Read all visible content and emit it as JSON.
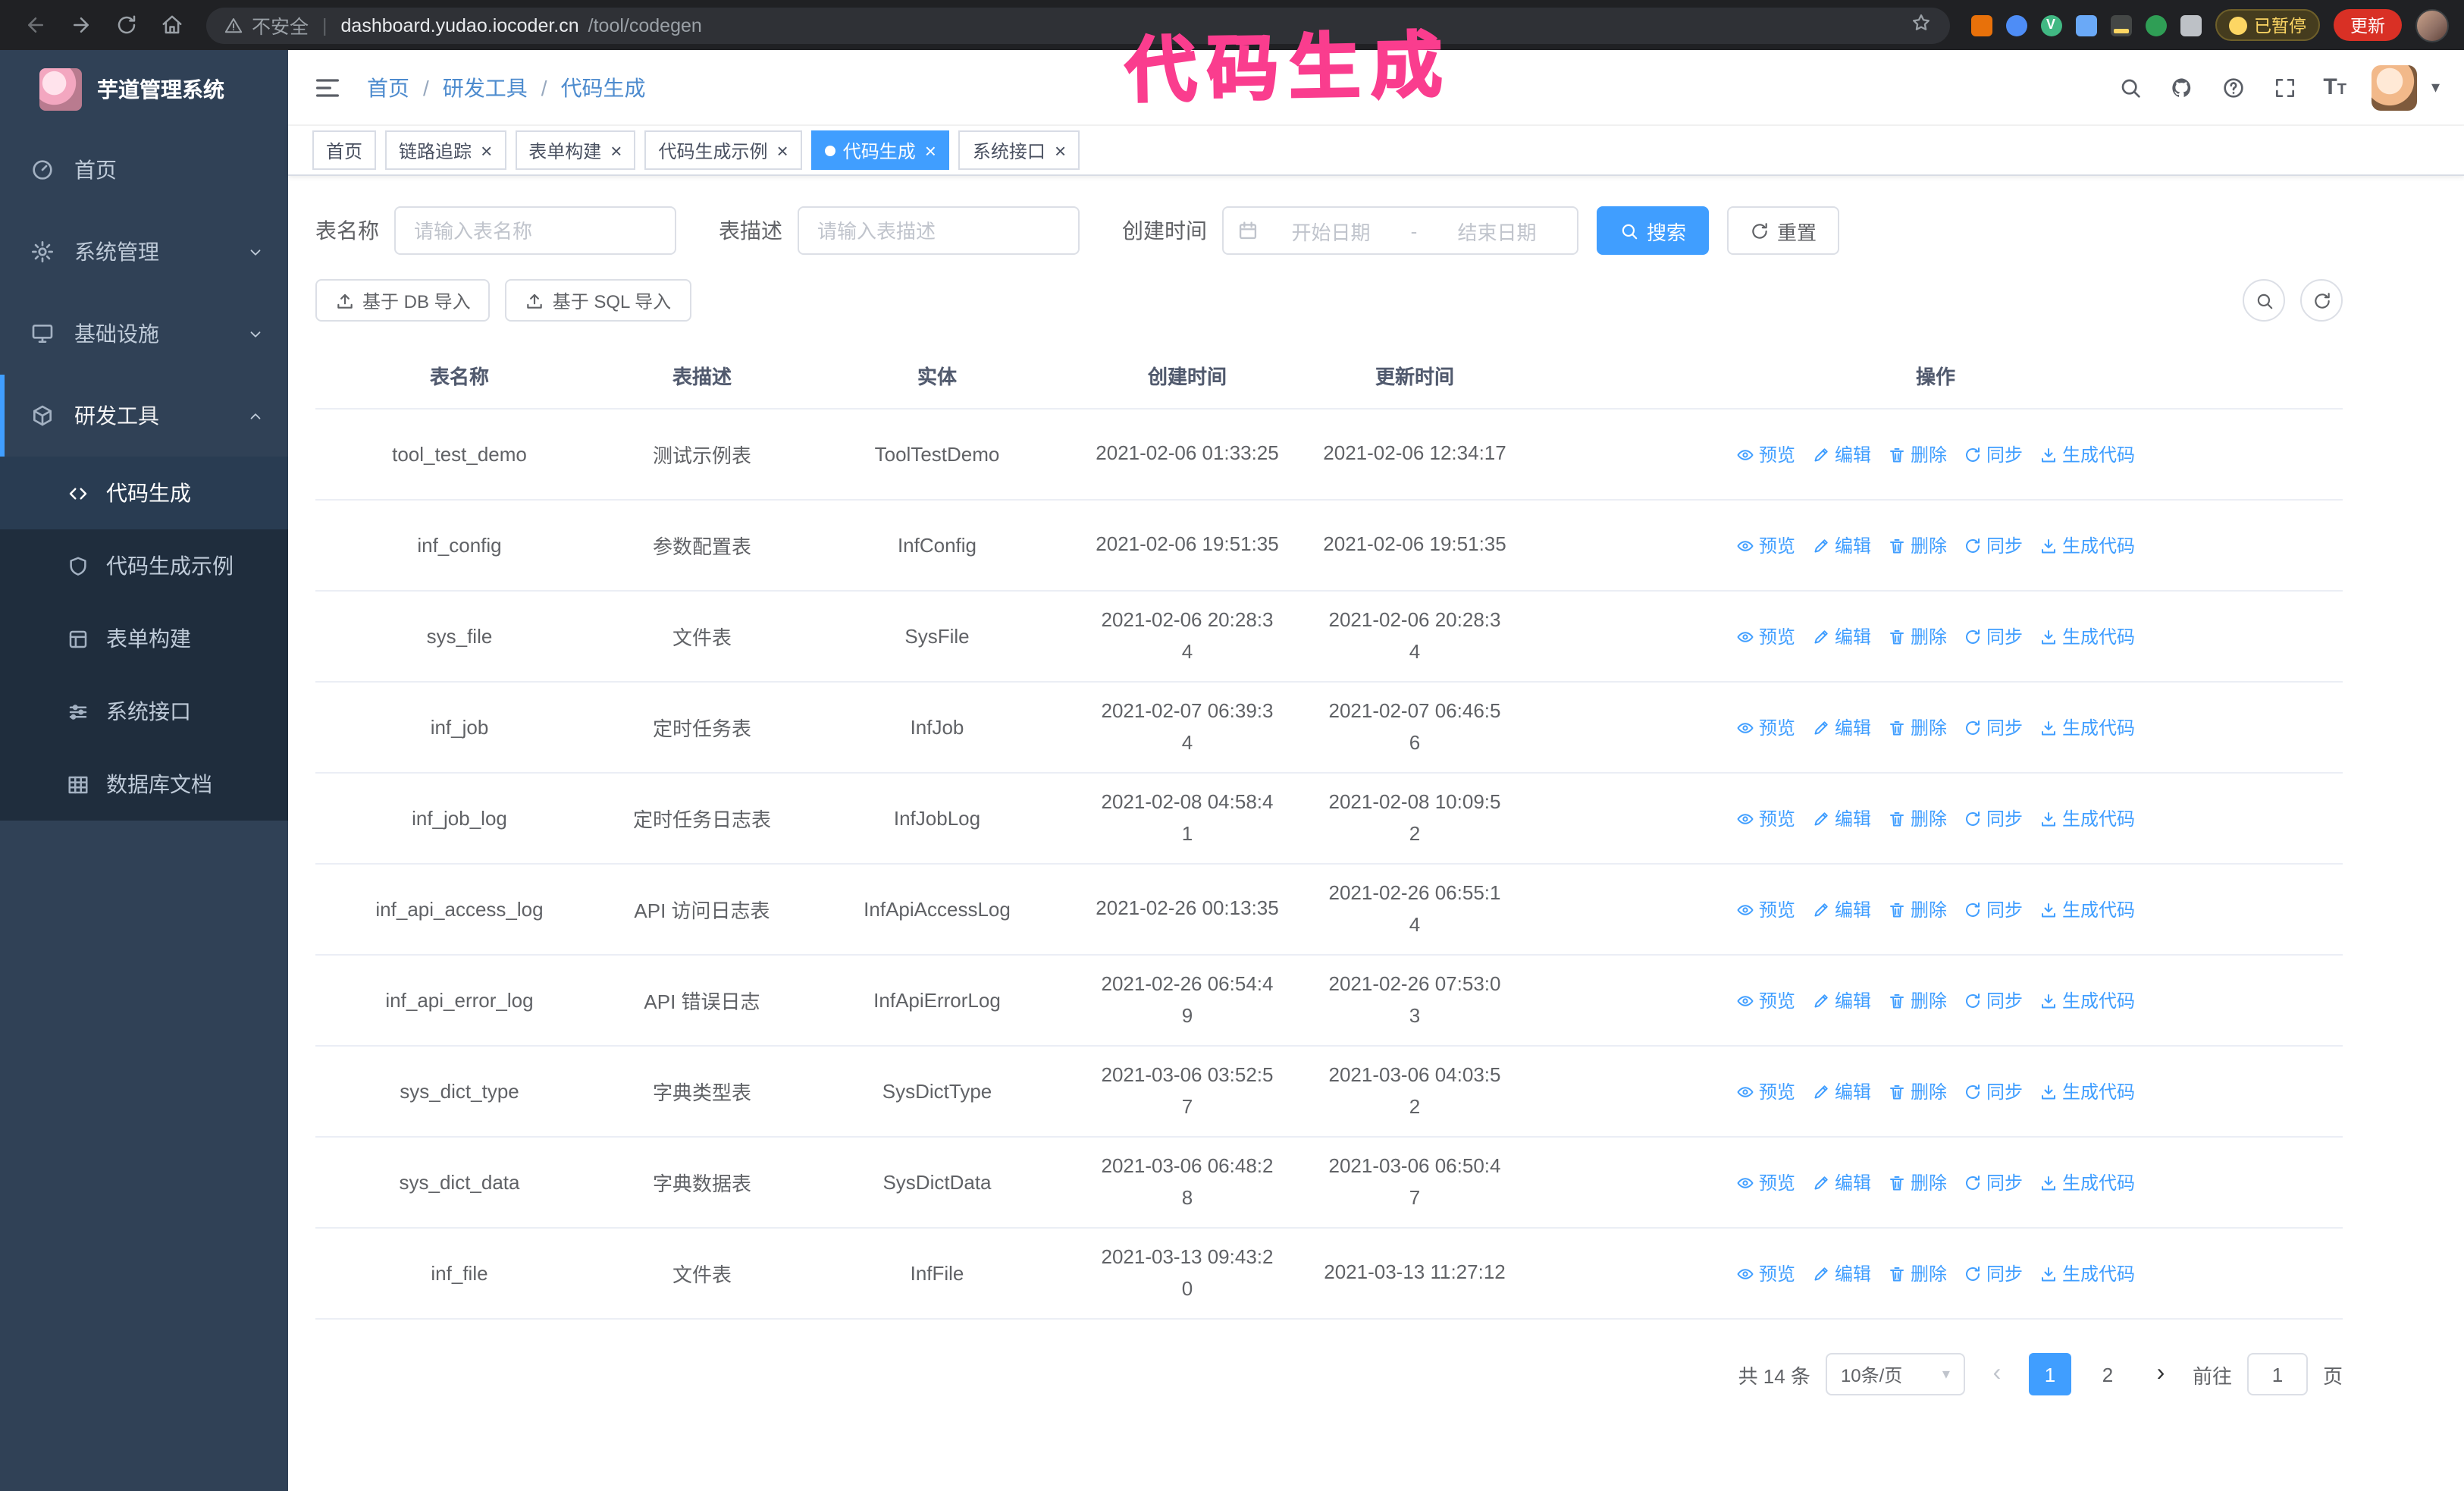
{
  "browser": {
    "not_secure_label": "不安全",
    "url_domain": "dashboard.yudao.iocoder.cn",
    "url_path": "/tool/codegen",
    "url_separator": "|",
    "paused_badge": "已暂停",
    "update_button": "更新"
  },
  "annotation": {
    "text": "代码生成"
  },
  "colors": {
    "accent": "#409eff",
    "annotation_pink": "#fa3d8e",
    "sidebar_bg": "#304156",
    "submenu_bg": "#1f2d3d",
    "update_button_red": "#d93025",
    "paused_badge_yellow": "#fdd663"
  },
  "icons": {
    "close": "×",
    "caret_down": "▾",
    "vue_letter": "V",
    "font_letter": "T"
  },
  "sidebar": {
    "logo_title": "芋道管理系统",
    "items": [
      {
        "label": "首页"
      },
      {
        "label": "系统管理"
      },
      {
        "label": "基础设施"
      },
      {
        "label": "研发工具"
      }
    ],
    "subitems": [
      {
        "label": "代码生成"
      },
      {
        "label": "代码生成示例"
      },
      {
        "label": "表单构建"
      },
      {
        "label": "系统接口"
      },
      {
        "label": "数据库文档"
      }
    ]
  },
  "header": {
    "breadcrumb": [
      "首页",
      "研发工具",
      "代码生成"
    ],
    "separator": "/"
  },
  "tabs": [
    {
      "label": "首页",
      "closable": false,
      "active": false
    },
    {
      "label": "链路追踪",
      "closable": true,
      "active": false
    },
    {
      "label": "表单构建",
      "closable": true,
      "active": false
    },
    {
      "label": "代码生成示例",
      "closable": true,
      "active": false
    },
    {
      "label": "代码生成",
      "closable": true,
      "active": true
    },
    {
      "label": "系统接口",
      "closable": true,
      "active": false
    }
  ],
  "filters": {
    "table_name_label": "表名称",
    "table_name_placeholder": "请输入表名称",
    "table_desc_label": "表描述",
    "table_desc_placeholder": "请输入表描述",
    "create_time_label": "创建时间",
    "date_start_placeholder": "开始日期",
    "date_separator": "-",
    "date_end_placeholder": "结束日期",
    "search_button": "搜索",
    "reset_button": "重置"
  },
  "toolbar": {
    "import_db_button": "基于 DB 导入",
    "import_sql_button": "基于 SQL 导入"
  },
  "table": {
    "columns": [
      "表名称",
      "表描述",
      "实体",
      "创建时间",
      "更新时间",
      "操作"
    ],
    "actions": [
      "预览",
      "编辑",
      "删除",
      "同步",
      "生成代码"
    ],
    "rows": [
      {
        "name": "tool_test_demo",
        "desc": "测试示例表",
        "entity": "ToolTestDemo",
        "created": "2021-02-06 01:33:25",
        "updated": "2021-02-06 12:34:17"
      },
      {
        "name": "inf_config",
        "desc": "参数配置表",
        "entity": "InfConfig",
        "created": "2021-02-06 19:51:35",
        "updated": "2021-02-06 19:51:35"
      },
      {
        "name": "sys_file",
        "desc": "文件表",
        "entity": "SysFile",
        "created": "2021-02-06 20:28:3\n4",
        "updated": "2021-02-06 20:28:3\n4"
      },
      {
        "name": "inf_job",
        "desc": "定时任务表",
        "entity": "InfJob",
        "created": "2021-02-07 06:39:3\n4",
        "updated": "2021-02-07 06:46:5\n6"
      },
      {
        "name": "inf_job_log",
        "desc": "定时任务日志表",
        "entity": "InfJobLog",
        "created": "2021-02-08 04:58:4\n1",
        "updated": "2021-02-08 10:09:5\n2"
      },
      {
        "name": "inf_api_access_log",
        "desc": "API 访问日志表",
        "entity": "InfApiAccessLog",
        "created": "2021-02-26 00:13:35",
        "updated": "2021-02-26 06:55:1\n4"
      },
      {
        "name": "inf_api_error_log",
        "desc": "API 错误日志",
        "entity": "InfApiErrorLog",
        "created": "2021-02-26 06:54:4\n9",
        "updated": "2021-02-26 07:53:0\n3"
      },
      {
        "name": "sys_dict_type",
        "desc": "字典类型表",
        "entity": "SysDictType",
        "created": "2021-03-06 03:52:5\n7",
        "updated": "2021-03-06 04:03:5\n2"
      },
      {
        "name": "sys_dict_data",
        "desc": "字典数据表",
        "entity": "SysDictData",
        "created": "2021-03-06 06:48:2\n8",
        "updated": "2021-03-06 06:50:4\n7"
      },
      {
        "name": "inf_file",
        "desc": "文件表",
        "entity": "InfFile",
        "created": "2021-03-13 09:43:2\n0",
        "updated": "2021-03-13 11:27:12"
      }
    ]
  },
  "pagination": {
    "total_text": "共 14 条",
    "page_size": "10条/页",
    "prev": "‹",
    "next": "›",
    "pages": [
      "1",
      "2"
    ],
    "active_page": "1",
    "goto_label": "前往",
    "goto_value": "1",
    "goto_unit": "页"
  }
}
